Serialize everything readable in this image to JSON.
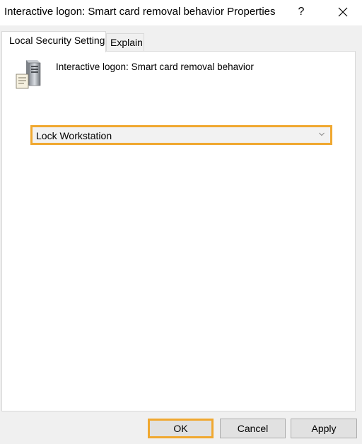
{
  "window": {
    "title": "Interactive logon: Smart card removal behavior Properties",
    "help_label": "?",
    "close_icon": "close-icon"
  },
  "tabs": [
    {
      "label": "Local Security Setting",
      "active": true
    },
    {
      "label": "Explain",
      "active": false
    }
  ],
  "setting": {
    "icon": "server-policy-icon",
    "name": "Interactive logon: Smart card removal behavior"
  },
  "dropdown": {
    "selected": "Lock Workstation",
    "icon": "chevron-down-icon"
  },
  "buttons": {
    "ok": "OK",
    "cancel": "Cancel",
    "apply": "Apply"
  },
  "colors": {
    "highlight": "#f0a830",
    "panel_bg": "#ffffff",
    "window_bg": "#f0f0f0"
  }
}
